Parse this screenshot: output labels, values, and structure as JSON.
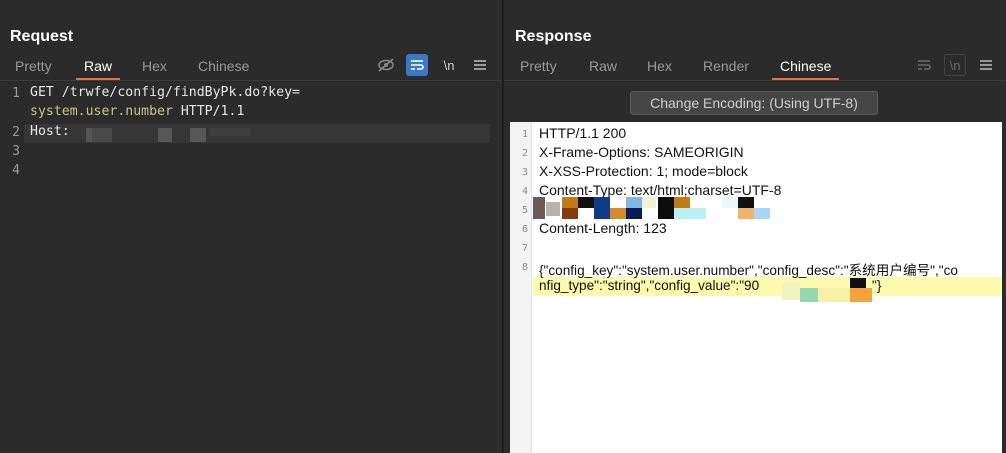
{
  "view_toggles": {
    "active": "split-vertical"
  },
  "request": {
    "title": "Request",
    "tabs": [
      "Pretty",
      "Raw",
      "Hex",
      "Chinese"
    ],
    "active_tab": "Raw",
    "tools": {
      "hide_icon": "eye-off-icon",
      "wrap_icon": "wrap-icon",
      "newline_label": "\\n",
      "menu_icon": "menu-icon"
    },
    "gutter": [
      "1",
      "2",
      "3",
      "4"
    ],
    "lines": {
      "l1_a": "GET /trwfe/config/findByPk.do?key=",
      "l1_b": "system.user.number",
      "l1_c": " HTTP/1.1",
      "l2_a": "Host: "
    }
  },
  "response": {
    "title": "Response",
    "tabs": [
      "Pretty",
      "Raw",
      "Hex",
      "Render",
      "Chinese"
    ],
    "active_tab": "Chinese",
    "tools": {
      "wrap_icon": "wrap-icon",
      "newline_label": "\\n",
      "menu_icon": "menu-icon"
    },
    "encoding_button": "Change Encoding: (Using UTF-8)",
    "gutter": [
      "1",
      "2",
      "3",
      "4",
      "5",
      "6",
      "7",
      "8"
    ],
    "lines": {
      "l1": "HTTP/1.1 200",
      "l2": "X-Frame-Options: SAMEORIGIN",
      "l3": "X-XSS-Protection: 1; mode=block",
      "l4": "Content-Type: text/html;charset=UTF-8",
      "l6": "Content-Length: 123",
      "l8_a": "{\"config_key\":\"system.user.number\",\"config_desc\":\"系统用户编号\",\"co",
      "l8_b": "nfig_type\":\"string\",\"config_value\":\"90",
      "l8_c": "\"}"
    }
  }
}
